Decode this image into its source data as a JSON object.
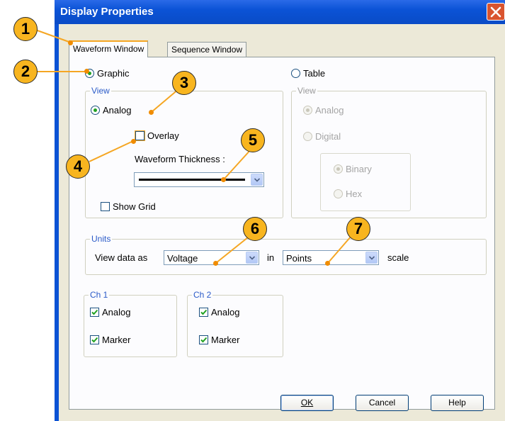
{
  "dialog": {
    "title": "Display Properties",
    "tabs": [
      {
        "label": "Waveform Window",
        "active": true
      },
      {
        "label": "Sequence Window",
        "active": false
      }
    ],
    "colors": {
      "titlebar": "#0b53d6",
      "accent_radio": "#21a121",
      "group_label": "#2b5bc8",
      "callout": "#f8b51f"
    }
  },
  "display_mode": {
    "graphic_label": "Graphic",
    "graphic_checked": true,
    "table_label": "Table",
    "table_checked": false
  },
  "graphic_view": {
    "legend": "View",
    "analog_label": "Analog",
    "analog_checked": true,
    "overlay_label": "Overlay",
    "overlay_checked": false,
    "thickness_label": "Waveform Thickness :",
    "show_grid_label": "Show Grid",
    "show_grid_checked": false
  },
  "table_view": {
    "legend": "View",
    "analog_label": "Analog",
    "digital_label": "Digital",
    "binary_label": "Binary",
    "hex_label": "Hex",
    "disabled": true
  },
  "units": {
    "legend": "Units",
    "view_data_as_label": "View data as",
    "data_value": "Voltage",
    "in_label": "in",
    "scale_value": "Points",
    "scale_label": "scale"
  },
  "ch1": {
    "legend": "Ch 1",
    "analog_label": "Analog",
    "analog_checked": true,
    "marker_label": "Marker",
    "marker_checked": true
  },
  "ch2": {
    "legend": "Ch 2",
    "analog_label": "Analog",
    "analog_checked": true,
    "marker_label": "Marker",
    "marker_checked": true
  },
  "buttons": {
    "ok": "OK",
    "cancel": "Cancel",
    "help": "Help"
  },
  "callouts": [
    "1",
    "2",
    "3",
    "4",
    "5",
    "6",
    "7"
  ]
}
